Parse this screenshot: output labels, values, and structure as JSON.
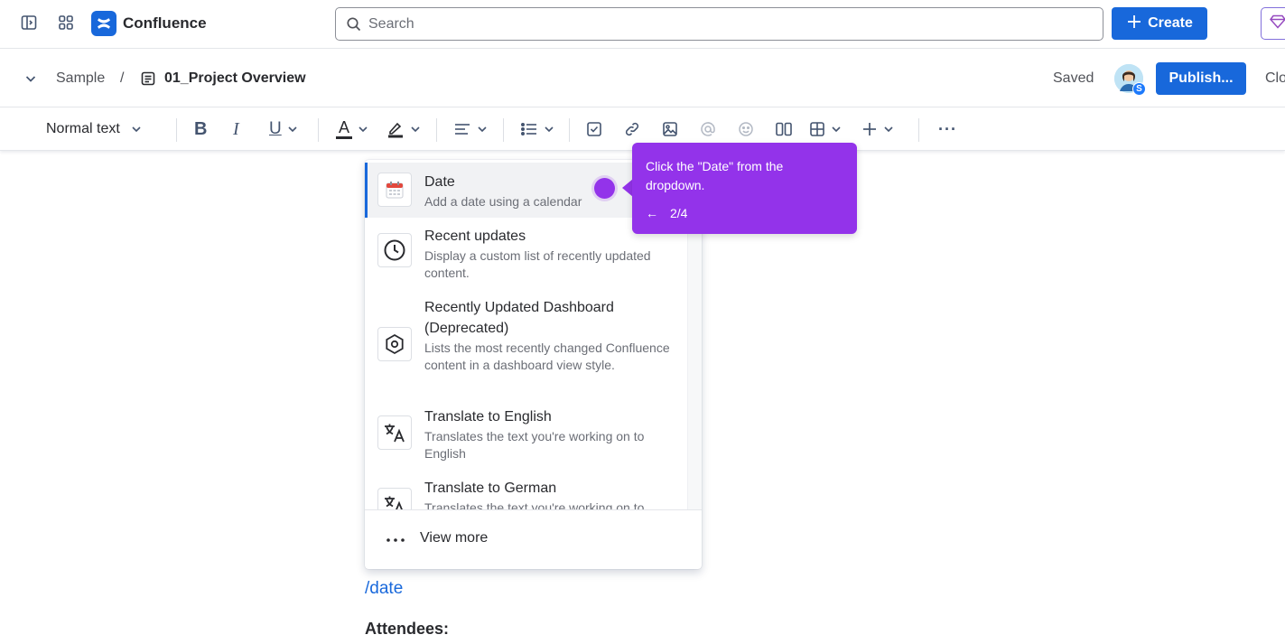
{
  "topbar": {
    "app_name": "Confluence",
    "search_placeholder": "Search",
    "create_label": "Create"
  },
  "breadcrumb": {
    "space": "Sample",
    "separator": "/",
    "page_title": "01_Project Overview",
    "status": "Saved",
    "avatar_badge": "S",
    "publish_label": "Publish...",
    "close_label": "Clo"
  },
  "toolbar": {
    "text_style": "Normal text",
    "bold_label": "B",
    "italic_label": "I",
    "underline_label": "U",
    "text_color_label": "A",
    "more_label": "···"
  },
  "dropdown": {
    "items": [
      {
        "title": "Date",
        "description": "Add a date using a calendar",
        "icon": "calendar-icon",
        "selected": true
      },
      {
        "title": "Recent updates",
        "description": "Display a custom list of recently updated content.",
        "icon": "clock-icon"
      },
      {
        "title": "Recently Updated Dashboard (Deprecated)",
        "description": "Lists the most recently changed Confluence content in a dashboard view style.",
        "icon": "hexagon-icon"
      },
      {
        "title": "Translate to English",
        "description": "Translates the text you're working on to English",
        "icon": "translate-icon"
      },
      {
        "title": "Translate to German",
        "description": "Translates the text you're working on to",
        "icon": "translate-icon"
      }
    ],
    "view_more_label": "View more"
  },
  "guide": {
    "text": "Click the \"Date\" from the dropdown.",
    "back_arrow": "←",
    "step": "2/4",
    "accent_color": "#9333ea"
  },
  "editor": {
    "slash_command": "/date",
    "attendees_heading": "Attendees:"
  },
  "colors": {
    "brand_blue": "#1868db",
    "text_primary": "#292a2e",
    "text_subtle": "#6b6e76"
  }
}
